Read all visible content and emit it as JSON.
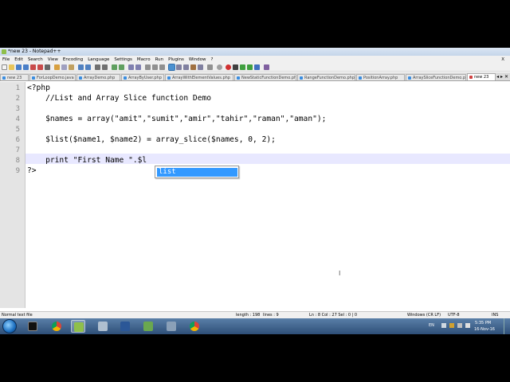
{
  "window": {
    "title": "*new 23 - Notepad++"
  },
  "menu": [
    "File",
    "Edit",
    "Search",
    "View",
    "Encoding",
    "Language",
    "Settings",
    "Macro",
    "Run",
    "Plugins",
    "Window",
    "?"
  ],
  "menu_close": "X",
  "tabs": [
    "new 23",
    "ForLoopDemo.java",
    "ArrayDemo.php",
    "ArrayByUser.php",
    "ArrayWithElementValues.php",
    "NewStaticFunctionDemo.php",
    "RangeFunctionDemo.php",
    "PositionArray.php",
    "ArraySliceFunctionDemo.php",
    "new 23"
  ],
  "tab_nav": "◂ ▸ ✕",
  "editor": {
    "line_numbers": [
      "1",
      "2",
      "3",
      "4",
      "5",
      "6",
      "7",
      "8",
      "9"
    ],
    "lines": [
      "<?php",
      "    //List and Array Slice function Demo",
      "",
      "    $names = array(\"amit\",\"sumit\",\"amir\",\"tahir\",\"raman\",\"aman\");",
      "",
      "    $list($name1, $name2) = array_slice($names, 0, 2);",
      "",
      "    print \"First Name \".$l",
      "?>"
    ],
    "autocomplete": [
      "list"
    ],
    "cursor_glyph": "I"
  },
  "status": {
    "file_type": "Normal text file",
    "length": "length : 198",
    "lines": "lines : 9",
    "position": "Ln : 8    Col : 27    Sel : 0 | 0",
    "eol": "Windows (CR LF)",
    "encoding": "UTF-8",
    "mode": "INS"
  },
  "taskbar": {
    "language": "EN",
    "time": "5:35 PM",
    "date": "16-Nov-16"
  }
}
